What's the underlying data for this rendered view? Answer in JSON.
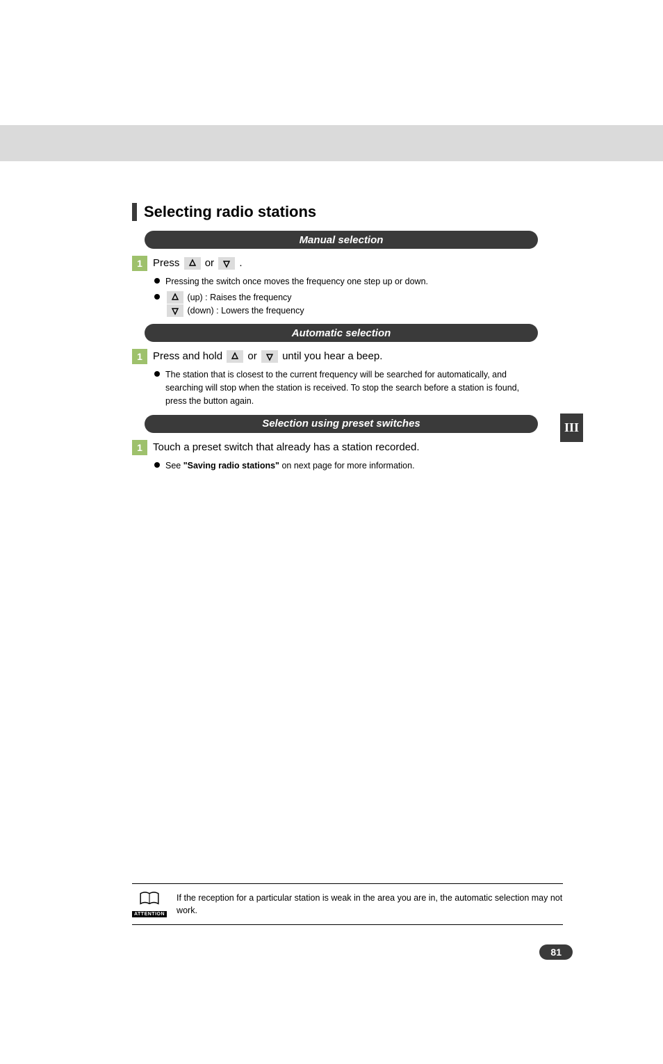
{
  "section_title": "Selecting radio stations",
  "manual": {
    "heading": "Manual selection",
    "step_label": "1",
    "step_text_pre": "Press ",
    "step_text_mid": " or ",
    "step_text_post": " .",
    "bullets": {
      "b1": "Pressing the switch once moves the frequency one step up or down.",
      "b2_up": " (up) : Raises the frequency",
      "b2_down": " (down) : Lowers the frequency"
    }
  },
  "automatic": {
    "heading": "Automatic selection",
    "step_label": "1",
    "step_text_pre": "Press and hold ",
    "step_text_mid": " or ",
    "step_text_post": " until you hear a beep.",
    "bullet": "The station that is closest to the current frequency will be searched for automatically, and searching will stop when the station is received. To stop the search before a station is found, press the button again."
  },
  "preset": {
    "heading": "Selection using preset switches",
    "step_label": "1",
    "step_text": "Touch a preset switch that already has a station recorded.",
    "bullet_pre": "See ",
    "bullet_ref": "\"Saving radio stations\"",
    "bullet_post": " on next page for more information."
  },
  "attention": {
    "label": "ATTENTION",
    "text": "If the reception for a particular station is weak in the area you are in, the automatic selection may not work."
  },
  "side_tab": "III",
  "page_number": "81"
}
